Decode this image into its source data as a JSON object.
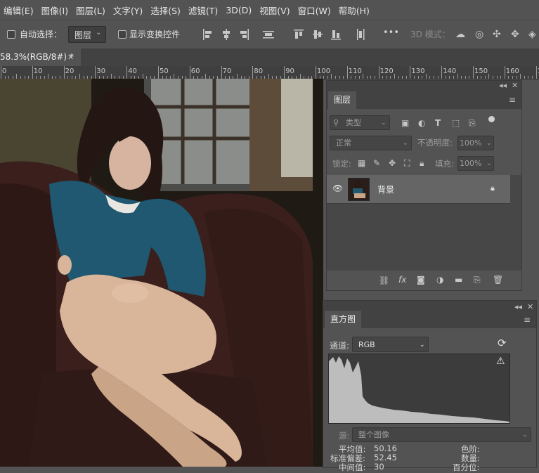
{
  "menu": [
    "编辑(E)",
    "图像(I)",
    "图层(L)",
    "文字(Y)",
    "选择(S)",
    "滤镜(T)",
    "3D(D)",
    "视图(V)",
    "窗口(W)",
    "帮助(H)"
  ],
  "options": {
    "auto_select_label": "自动选择：",
    "auto_select_value": "图层",
    "show_transform_label": "显示变换控件",
    "more": "•••",
    "mode_3d_label": "3D 模式："
  },
  "doc_tab": {
    "title": "58.3%(RGB/8#) *",
    "close": "✕"
  },
  "ruler_labels": [
    "0",
    "10",
    "20",
    "30",
    "40",
    "50",
    "60",
    "70",
    "80",
    "90",
    "100",
    "110",
    "120",
    "130",
    "140",
    "150",
    "160",
    "170"
  ],
  "layers_panel": {
    "tab": "图层",
    "filter_type": "类型",
    "blend_mode": "正常",
    "opacity_label": "不透明度:",
    "opacity_value": "100%",
    "lock_label": "锁定:",
    "fill_label": "填充:",
    "fill_value": "100%",
    "layer_name": "背景",
    "collapse": "◂◂",
    "close": "✕"
  },
  "histogram_panel": {
    "tab": "直方图",
    "channel_label": "通道:",
    "channel_value": "RGB",
    "source_label": "源:",
    "source_value": "整个图像",
    "mean_label": "平均值:",
    "mean_value": "50.16",
    "std_label": "标准偏差:",
    "std_value": "52.45",
    "median_label": "中间值:",
    "median_value": "30",
    "level_label": "色阶:",
    "count_label": "数量:",
    "percentile_label": "百分位:",
    "collapse": "◂◂",
    "close": "✕"
  },
  "colors": {
    "ui_bg": "#535353",
    "dark_bg": "#424242",
    "accent_blue": "#1f5870",
    "sofa": "#3a1f1c"
  }
}
